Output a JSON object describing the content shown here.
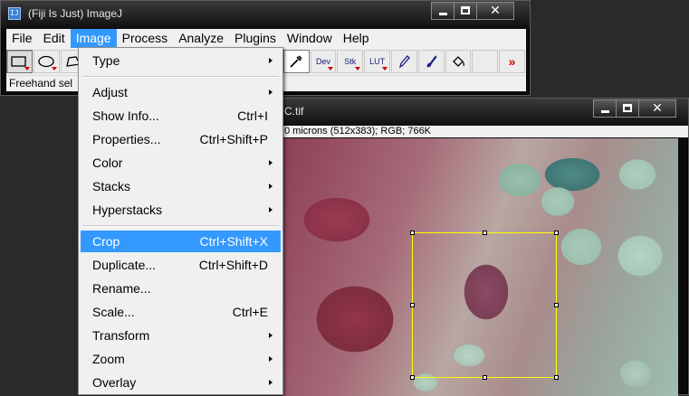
{
  "main_window": {
    "title": "(Fiji Is Just) ImageJ",
    "icon_text": "IJ",
    "menubar": [
      "File",
      "Edit",
      "Image",
      "Process",
      "Analyze",
      "Plugins",
      "Window",
      "Help"
    ],
    "active_menu": "Image",
    "status_text": "Freehand sel",
    "toolbar": {
      "dev_label": "Dev",
      "stk_label": "Stk",
      "lut_label": "LUT",
      "more_label": "»"
    }
  },
  "image_window": {
    "title_fragment": "C.tif",
    "info_text": "0 microns (512x383); RGB; 766K"
  },
  "image_menu": {
    "items": [
      {
        "label": "Type",
        "shortcut": "",
        "submenu": true
      },
      {
        "label": "Adjust",
        "shortcut": "",
        "submenu": true
      },
      {
        "label": "Show Info...",
        "shortcut": "Ctrl+I",
        "submenu": false
      },
      {
        "label": "Properties...",
        "shortcut": "Ctrl+Shift+P",
        "submenu": false
      },
      {
        "label": "Color",
        "shortcut": "",
        "submenu": true
      },
      {
        "label": "Stacks",
        "shortcut": "",
        "submenu": true
      },
      {
        "label": "Hyperstacks",
        "shortcut": "",
        "submenu": true
      },
      {
        "label": "Crop",
        "shortcut": "Ctrl+Shift+X",
        "submenu": false,
        "highlighted": true
      },
      {
        "label": "Duplicate...",
        "shortcut": "Ctrl+Shift+D",
        "submenu": false
      },
      {
        "label": "Rename...",
        "shortcut": "",
        "submenu": false
      },
      {
        "label": "Scale...",
        "shortcut": "Ctrl+E",
        "submenu": false
      },
      {
        "label": "Transform",
        "shortcut": "",
        "submenu": true
      },
      {
        "label": "Zoom",
        "shortcut": "",
        "submenu": true
      },
      {
        "label": "Overlay",
        "shortcut": "",
        "submenu": true
      }
    ]
  },
  "colors": {
    "highlight": "#3399ff",
    "roi": "#ffff00",
    "menu_bg": "#f0f0f0"
  }
}
